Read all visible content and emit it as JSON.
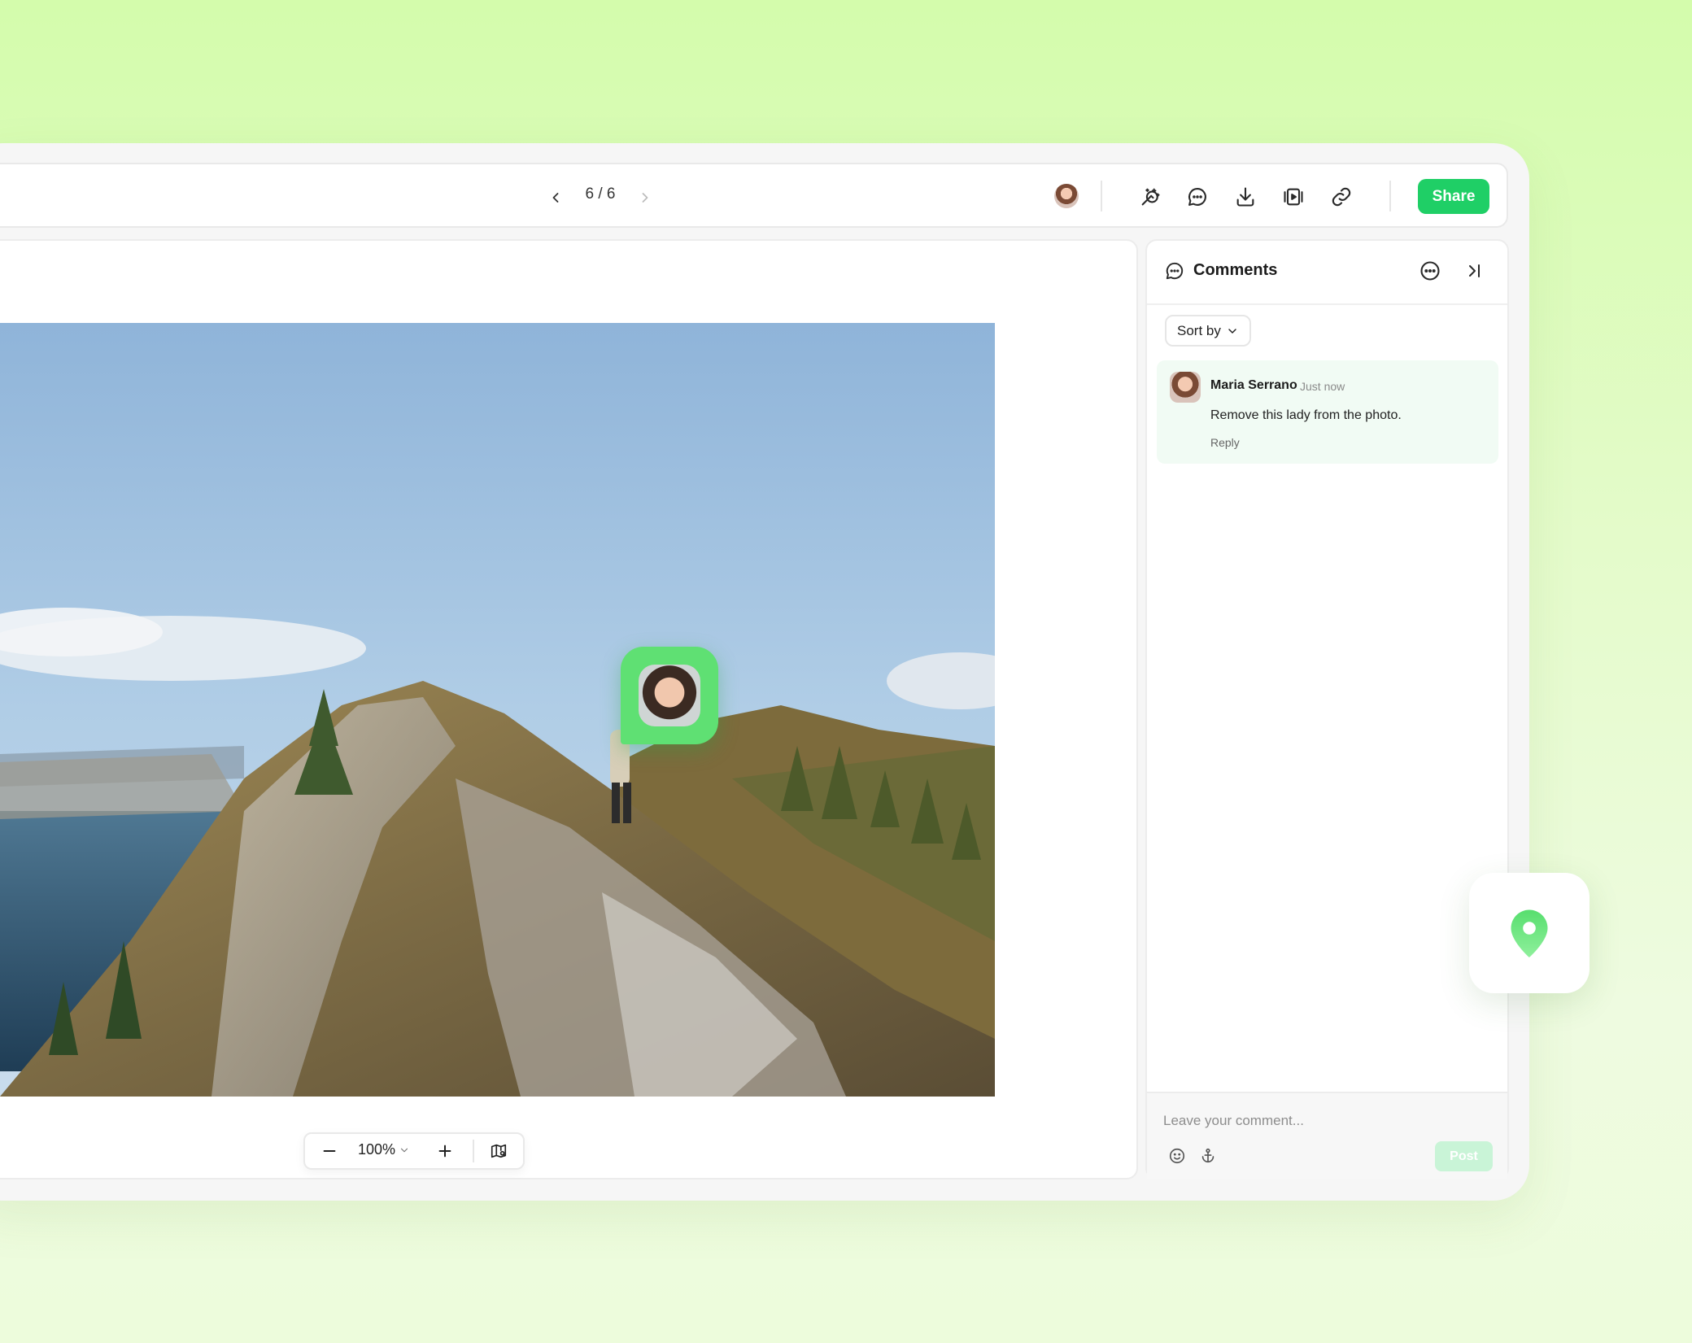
{
  "toolbar": {
    "pager": "6 / 6",
    "prev_icon": "chevron-left-icon",
    "next_icon": "chevron-right-icon",
    "share_label": "Share",
    "actions": [
      "magic-edit-icon",
      "comment-icon",
      "download-icon",
      "slideshow-icon",
      "link-icon"
    ]
  },
  "canvas": {
    "zoom_label": "100%",
    "zoom_controls": [
      "minus-icon",
      "plus-icon",
      "minimap-icon"
    ]
  },
  "comments": {
    "title": "Comments",
    "sort_label": "Sort by",
    "items": [
      {
        "author": "Maria Serrano",
        "time": "Just now",
        "text": "Remove this lady from the photo.",
        "reply_label": "Reply"
      }
    ],
    "compose_placeholder": "Leave your comment...",
    "post_label": "Post"
  },
  "colors": {
    "accent": "#1fcf66",
    "pin_bubble": "#5fe073",
    "background": "#d4fcac"
  }
}
